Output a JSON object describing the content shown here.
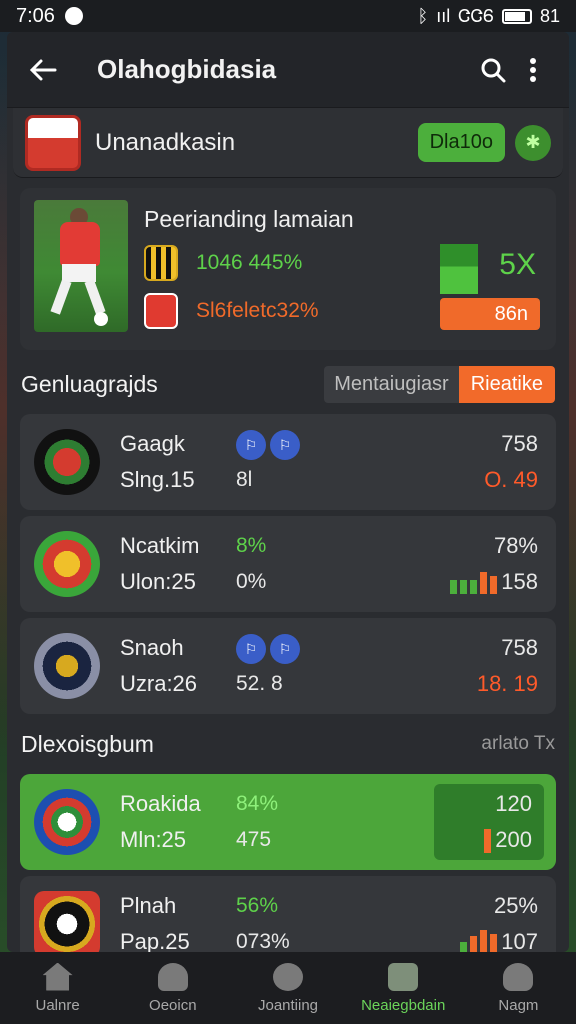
{
  "status": {
    "time": "7:06",
    "right_text": "ᛒ",
    "signal": "ııl",
    "network": "ᏣᏣᏮ",
    "battery_pct": "81"
  },
  "appbar": {
    "title": "Olahogbidasia",
    "back_icon": "arrow-left-icon",
    "search_icon": "search-icon",
    "more_icon": "more-vert-icon"
  },
  "pinned": {
    "name": "Unanadkasin",
    "pill": "Dla10o",
    "action_icon": "refresh-icon"
  },
  "featured": {
    "title": "Peerianding lamaian",
    "row1": "1046 445%",
    "row2": "Sl6feletc32%",
    "big_pct": "5X",
    "orange_value": "86n",
    "colors": {
      "green": "#5ed24a",
      "orange": "#f06a2a"
    }
  },
  "section1": {
    "title": "Genluagrajds",
    "seg_off": "Mentaiugiasr",
    "seg_on": "Rieatike",
    "items": [
      {
        "name": "Gaagk",
        "sub": "Slng.15",
        "col2_top": "",
        "col2_bottom": "8l",
        "right_top": "758",
        "right_bottom": "O. 49",
        "right_bottom_color": "#ff5a2a"
      },
      {
        "name": "Ncatkim",
        "sub": "Ulon:25",
        "col2_top": "8%",
        "col2_bottom": "0%",
        "right_top": "78%",
        "right_bottom": "158",
        "right_bottom_color": "#f0f0f0"
      },
      {
        "name": "Snaoh",
        "sub": "Uzra:26",
        "col2_top": "",
        "col2_bottom": "52. 8",
        "right_top": "758",
        "right_bottom": "18. 19",
        "right_bottom_color": "#ff5a2a"
      }
    ]
  },
  "section2": {
    "title": "Dlexoisgbum",
    "link": "arlato Tx",
    "items": [
      {
        "name": "Roakida",
        "sub": "Mln:25",
        "col2_top": "84%",
        "col2_bottom": "475",
        "right_top": "120",
        "right_bottom": "200"
      },
      {
        "name": "Plnah",
        "sub": "Pap.25",
        "col2_top": "56%",
        "col2_bottom": "073%",
        "right_top": "25%",
        "right_bottom": "107"
      }
    ]
  },
  "nav": [
    {
      "label": "Ualnre",
      "icon": "home-icon"
    },
    {
      "label": "Oeoicn",
      "icon": "coach-icon"
    },
    {
      "label": "Joantiing",
      "icon": "ball-icon"
    },
    {
      "label": "Neaiegbdain",
      "icon": "stats-icon"
    },
    {
      "label": "Nagm",
      "icon": "profile-icon"
    }
  ]
}
